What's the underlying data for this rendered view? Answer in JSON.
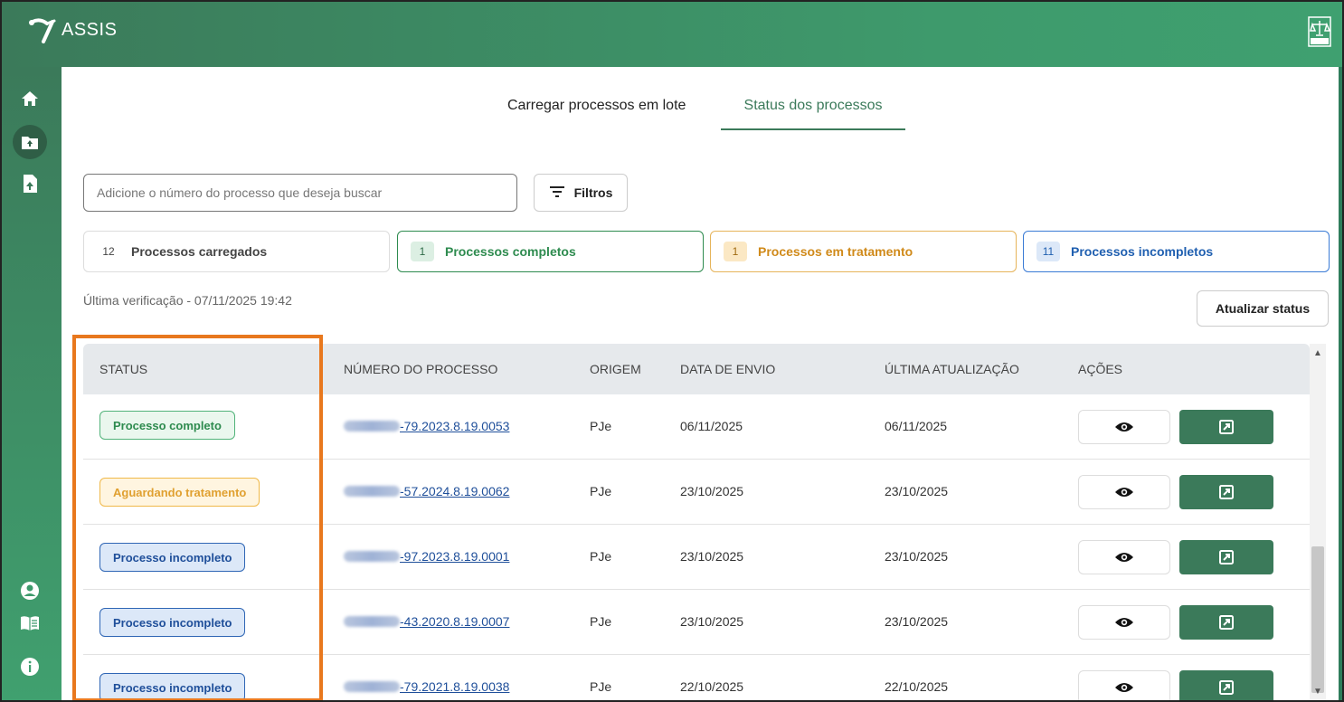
{
  "app": {
    "title": "ASSIS",
    "emblem_text": "PJERJ"
  },
  "sidebar": {
    "items": [
      {
        "icon": "home-icon"
      },
      {
        "icon": "upload-folder-icon"
      },
      {
        "icon": "file-upload-icon"
      },
      {
        "icon": "account-icon"
      },
      {
        "icon": "book-icon"
      },
      {
        "icon": "info-icon"
      }
    ]
  },
  "tabs": [
    {
      "label": "Carregar processos em lote",
      "active": false
    },
    {
      "label": "Status dos processos",
      "active": true
    }
  ],
  "search": {
    "placeholder": "Adicione o número do processo que deseja buscar"
  },
  "filters": {
    "label": "Filtros"
  },
  "summary": {
    "loaded": {
      "count": "12",
      "label": "Processos carregados"
    },
    "complete": {
      "count": "1",
      "label": "Processos completos"
    },
    "in_treatment": {
      "count": "1",
      "label": "Processos em tratamento"
    },
    "incomplete": {
      "count": "11",
      "label": "Processos incompletos"
    }
  },
  "last_check": "Última verificação - 07/11/2025 19:42",
  "refresh_label": "Atualizar status",
  "table": {
    "headers": {
      "status": "STATUS",
      "number": "NÚMERO DO PROCESSO",
      "origin": "ORIGEM",
      "sent": "DATA DE ENVIO",
      "updated": "ÚLTIMA ATUALIZAÇÃO",
      "actions": "AÇÕES"
    },
    "rows": [
      {
        "status": "Processo completo",
        "status_kind": "complete",
        "number": "-79.2023.8.19.0053",
        "origin": "PJe",
        "sent": "06/11/2025",
        "updated": "06/11/2025"
      },
      {
        "status": "Aguardando tratamento",
        "status_kind": "waiting",
        "number": "-57.2024.8.19.0062",
        "origin": "PJe",
        "sent": "23/10/2025",
        "updated": "23/10/2025"
      },
      {
        "status": "Processo incompleto",
        "status_kind": "incomplete",
        "number": "-97.2023.8.19.0001",
        "origin": "PJe",
        "sent": "23/10/2025",
        "updated": "23/10/2025"
      },
      {
        "status": "Processo incompleto",
        "status_kind": "incomplete",
        "number": "-43.2020.8.19.0007",
        "origin": "PJe",
        "sent": "23/10/2025",
        "updated": "23/10/2025"
      },
      {
        "status": "Processo incompleto",
        "status_kind": "incomplete",
        "number": "-79.2021.8.19.0038",
        "origin": "PJe",
        "sent": "22/10/2025",
        "updated": "22/10/2025"
      }
    ]
  },
  "colors": {
    "brand": "#3b7a5a",
    "complete": "#2e8b4f",
    "waiting": "#e0a030",
    "incomplete": "#1f5fb0",
    "highlight": "#e8781e"
  }
}
